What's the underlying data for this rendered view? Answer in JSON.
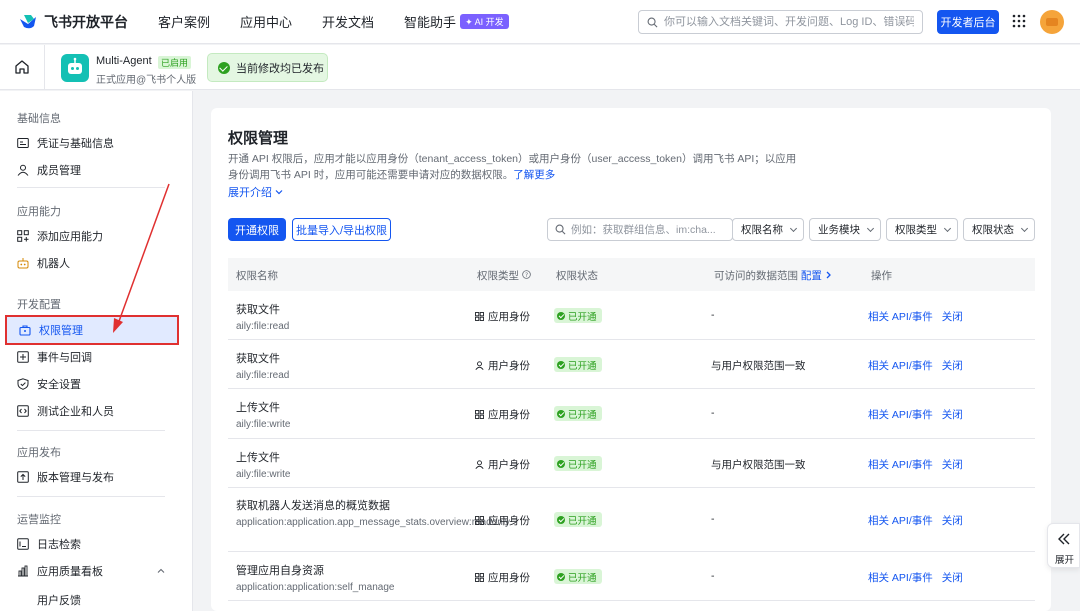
{
  "topnav": {
    "brand": "飞书开放平台",
    "items": [
      "客户案例",
      "应用中心",
      "开发文档",
      "智能助手"
    ],
    "ai_badge": "✦ AI 开发",
    "search_placeholder": "你可以输入文档关键词、开发问题、Log ID、错误码",
    "dev_console": "开发者后台"
  },
  "appbar": {
    "app_name": "Multi-Agent",
    "app_tag": "已启用",
    "app_sub": "正式应用@飞书个人版",
    "publish_status": "当前修改均已发布"
  },
  "sidebar": {
    "groups": [
      {
        "title": "基础信息",
        "items": [
          "凭证与基础信息",
          "成员管理"
        ]
      },
      {
        "title": "应用能力",
        "items": [
          "添加应用能力",
          "机器人"
        ]
      },
      {
        "title": "开发配置",
        "items": [
          "权限管理",
          "事件与回调",
          "安全设置",
          "测试企业和人员"
        ]
      },
      {
        "title": "应用发布",
        "items": [
          "版本管理与发布"
        ]
      },
      {
        "title": "运营监控",
        "items": [
          "日志检索",
          "应用质量看板"
        ]
      }
    ],
    "sub_item": "用户反馈"
  },
  "main": {
    "title": "权限管理",
    "desc": "开通 API 权限后，应用才能以应用身份（tenant_access_token）或用户身份（user_access_token）调用飞书 API；以应用身份调用飞书 API 时，应用可能还需要申请对应的数据权限。",
    "learn_more": "了解更多",
    "expand_intro": "展开介绍",
    "btn_enable": "开通权限",
    "btn_batch": "批量导入/导出权限",
    "filter_placeholder": "例如：获取群组信息、im:cha...",
    "filters": [
      "权限名称",
      "业务模块",
      "权限类型",
      "权限状态"
    ],
    "columns": [
      "权限名称",
      "权限类型",
      "权限状态",
      "可访问的数据范围",
      "配置",
      "操作"
    ],
    "rows": [
      {
        "name": "获取文件",
        "code": "aily:file:read",
        "type": "应用身份",
        "status": "已开通",
        "scope": "-",
        "op1": "相关 API/事件",
        "op2": "关闭"
      },
      {
        "name": "获取文件",
        "code": "aily:file:read",
        "type": "用户身份",
        "status": "已开通",
        "scope": "与用户权限范围一致",
        "op1": "相关 API/事件",
        "op2": "关闭"
      },
      {
        "name": "上传文件",
        "code": "aily:file:write",
        "type": "应用身份",
        "status": "已开通",
        "scope": "-",
        "op1": "相关 API/事件",
        "op2": "关闭"
      },
      {
        "name": "上传文件",
        "code": "aily:file:write",
        "type": "用户身份",
        "status": "已开通",
        "scope": "与用户权限范围一致",
        "op1": "相关 API/事件",
        "op2": "关闭"
      },
      {
        "name": "获取机器人发送消息的概览数据",
        "code": "application:application.app_message_stats.overview:readonly",
        "type": "应用身份",
        "status": "已开通",
        "scope": "-",
        "op1": "相关 API/事件",
        "op2": "关闭"
      },
      {
        "name": "管理应用自身资源",
        "code": "application:application:self_manage",
        "type": "应用身份",
        "status": "已开通",
        "scope": "-",
        "op1": "相关 API/事件",
        "op2": "关闭"
      }
    ]
  },
  "expand_panel": "展开"
}
